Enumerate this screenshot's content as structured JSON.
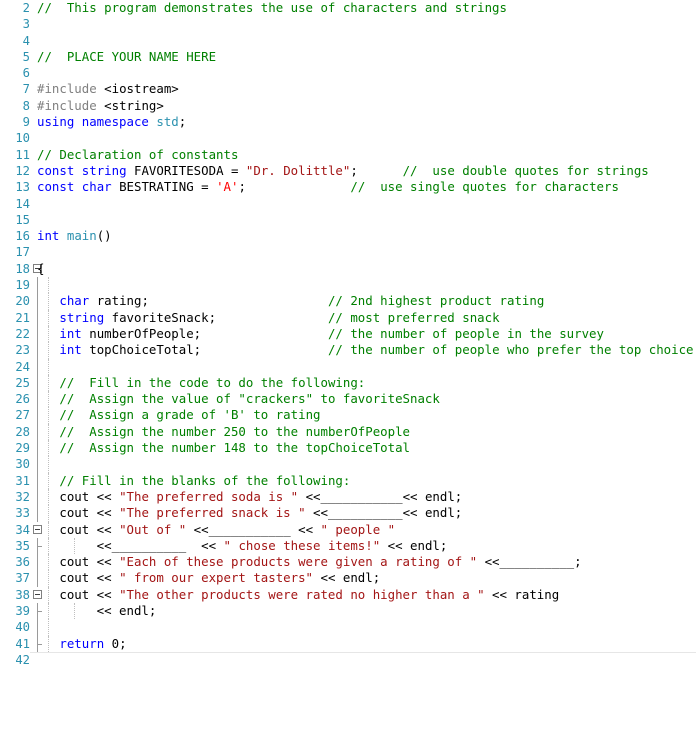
{
  "editor": {
    "language": "C++",
    "first_visible_line": 2,
    "last_visible_line": 42,
    "colors": {
      "background": "#FFFFFF",
      "line_number": "#2B91AF",
      "keyword": "#0000FF",
      "comment": "#008000",
      "string": "#A31515",
      "char_literal": "#FF0000",
      "preprocessor": "#808080",
      "type_identifier": "#2B91AF",
      "plain_text": "#000000",
      "fold_guide": "#9A9A9A",
      "indent_guide": "#BFBFBF"
    },
    "fold_markers": [
      18,
      34,
      38
    ]
  },
  "lines": [
    {
      "n": "2",
      "text": "   //  This program demonstrates the use of characters and strings"
    },
    {
      "n": "3",
      "text": ""
    },
    {
      "n": "4",
      "text": ""
    },
    {
      "n": "5",
      "text": "   //  PLACE YOUR NAME HERE"
    },
    {
      "n": "6",
      "text": ""
    },
    {
      "n": "7",
      "text": "   #include <iostream>"
    },
    {
      "n": "8",
      "text": "   #include <string>"
    },
    {
      "n": "9",
      "text": "   using namespace std;"
    },
    {
      "n": "10",
      "text": ""
    },
    {
      "n": "11",
      "text": "   // Declaration of constants"
    },
    {
      "n": "12",
      "text": "   const string FAVORITESODA = \"Dr. Dolittle\";      //  use double quotes for strings"
    },
    {
      "n": "13",
      "text": "   const char BESTRATING = 'A';                    //  use single quotes for characters"
    },
    {
      "n": "14",
      "text": ""
    },
    {
      "n": "15",
      "text": ""
    },
    {
      "n": "16",
      "text": "   int main()"
    },
    {
      "n": "17",
      "text": ""
    },
    {
      "n": "18",
      "text": "{"
    },
    {
      "n": "19",
      "text": ""
    },
    {
      "n": "20",
      "text": "      char rating;                        // 2nd highest product rating"
    },
    {
      "n": "21",
      "text": "      string favoriteSnack;               // most preferred snack"
    },
    {
      "n": "22",
      "text": "      int numberOfPeople;                 // the number of people in the survey"
    },
    {
      "n": "23",
      "text": "      int topChoiceTotal;                 // the number of people who prefer the top choice"
    },
    {
      "n": "24",
      "text": ""
    },
    {
      "n": "25",
      "text": "      //  Fill in the code to do the following:"
    },
    {
      "n": "26",
      "text": "      //  Assign the value of \"crackers\" to favoriteSnack"
    },
    {
      "n": "27",
      "text": "      //  Assign a grade of 'B' to rating"
    },
    {
      "n": "28",
      "text": "      //  Assign the number 250 to the numberOfPeople"
    },
    {
      "n": "29",
      "text": "      //  Assign the number 148 to the topChoiceTotal"
    },
    {
      "n": "30",
      "text": ""
    },
    {
      "n": "31",
      "text": "      // Fill in the blanks of the following:"
    },
    {
      "n": "32",
      "text": "      cout << \"The preferred soda is \" <<___________<< endl;"
    },
    {
      "n": "33",
      "text": "      cout << \"The preferred snack is \" <<__________<< endl;"
    },
    {
      "n": "34",
      "text": "      cout << \"Out of \" <<___________ << \" people \""
    },
    {
      "n": "35",
      "text": "           <<__________  << \" chose these items!\" << endl;"
    },
    {
      "n": "36",
      "text": "      cout << \"Each of these products were given a rating of \" <<__________;"
    },
    {
      "n": "37",
      "text": "      cout << \" from our expert tasters\" << endl;"
    },
    {
      "n": "38",
      "text": "      cout << \"The other products were rated no higher than a \" << rating"
    },
    {
      "n": "39",
      "text": "           << endl;"
    },
    {
      "n": "40",
      "text": ""
    },
    {
      "n": "41",
      "text": "      return 0;"
    },
    {
      "n": "42",
      "text": ""
    }
  ],
  "code_tokens": {
    "comment_prefix": "//",
    "include_directive": "#include",
    "headers": [
      "<iostream>",
      "<string>"
    ],
    "using_statement": "using namespace std;",
    "constants": [
      {
        "keyword": "const",
        "type": "string",
        "name": "FAVORITESODA",
        "value": "\"Dr. Dolittle\"",
        "comment": "//  use double quotes for strings"
      },
      {
        "keyword": "const",
        "type": "char",
        "name": "BESTRATING",
        "value": "'A'",
        "comment": "//  use single quotes for characters"
      }
    ],
    "function_signature": "int main()",
    "variables": [
      {
        "type": "char",
        "name": "rating",
        "comment": "// 2nd highest product rating"
      },
      {
        "type": "string",
        "name": "favoriteSnack",
        "comment": "// most preferred snack"
      },
      {
        "type": "int",
        "name": "numberOfPeople",
        "comment": "// the number of people in the survey"
      },
      {
        "type": "int",
        "name": "topChoiceTotal",
        "comment": "// the number of people who prefer the top choice"
      }
    ],
    "instructions": [
      "//  Fill in the code to do the following:",
      "//  Assign the value of \"crackers\" to favoriteSnack",
      "//  Assign a grade of 'B' to rating",
      "//  Assign the number 250 to the numberOfPeople",
      "//  Assign the number 148 to the topChoiceTotal"
    ],
    "blanks_instruction": "// Fill in the blanks of the following:",
    "output_strings": [
      "\"The preferred soda is \"",
      "\"The preferred snack is \"",
      "\"Out of \"",
      "\" people \"",
      "\" chose these items!\"",
      "\"Each of these products were given a rating of \"",
      "\" from our expert tasters\"",
      "\"The other products were rated no higher than a \""
    ],
    "return_statement": "return 0;"
  }
}
